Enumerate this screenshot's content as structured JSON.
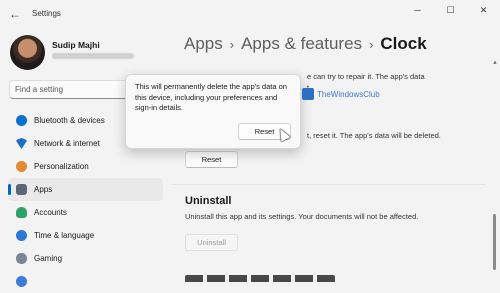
{
  "window": {
    "title": "Settings",
    "controls": {
      "minimize": "─",
      "maximize": "☐",
      "close": "✕"
    }
  },
  "user": {
    "name": "Sudip Majhi"
  },
  "search": {
    "placeholder": "Find a setting"
  },
  "sidebar": {
    "items": [
      {
        "label": "Bluetooth & devices",
        "icon": "bluetooth-icon"
      },
      {
        "label": "Network & internet",
        "icon": "network-icon"
      },
      {
        "label": "Personalization",
        "icon": "personalization-icon"
      },
      {
        "label": "Apps",
        "icon": "apps-icon",
        "selected": true
      },
      {
        "label": "Accounts",
        "icon": "accounts-icon"
      },
      {
        "label": "Time & language",
        "icon": "time-language-icon"
      },
      {
        "label": "Gaming",
        "icon": "gaming-icon"
      },
      {
        "label": "",
        "icon": "accessibility-icon"
      }
    ]
  },
  "breadcrumb": {
    "items": [
      "Apps",
      "Apps & features"
    ],
    "current": "Clock",
    "separator": "›"
  },
  "content": {
    "repair_text_partial": "e can try to repair it. The app's data",
    "repair_text_partial2": "t.",
    "reset_text_partial": "t, reset it. The app's data will be deleted.",
    "reset_button": "Reset",
    "uninstall_heading": "Uninstall",
    "uninstall_desc": "Uninstall this app and its settings. Your documents will not be affected.",
    "uninstall_button": "Uninstall"
  },
  "flyout": {
    "text": "This will permanently delete the app's data on this device, including your preferences and sign-in details.",
    "button": "Reset"
  },
  "watermark": {
    "text": "TheWindowsClub"
  },
  "colors": {
    "accent": "#0067c0",
    "background": "#f3f3f3"
  }
}
